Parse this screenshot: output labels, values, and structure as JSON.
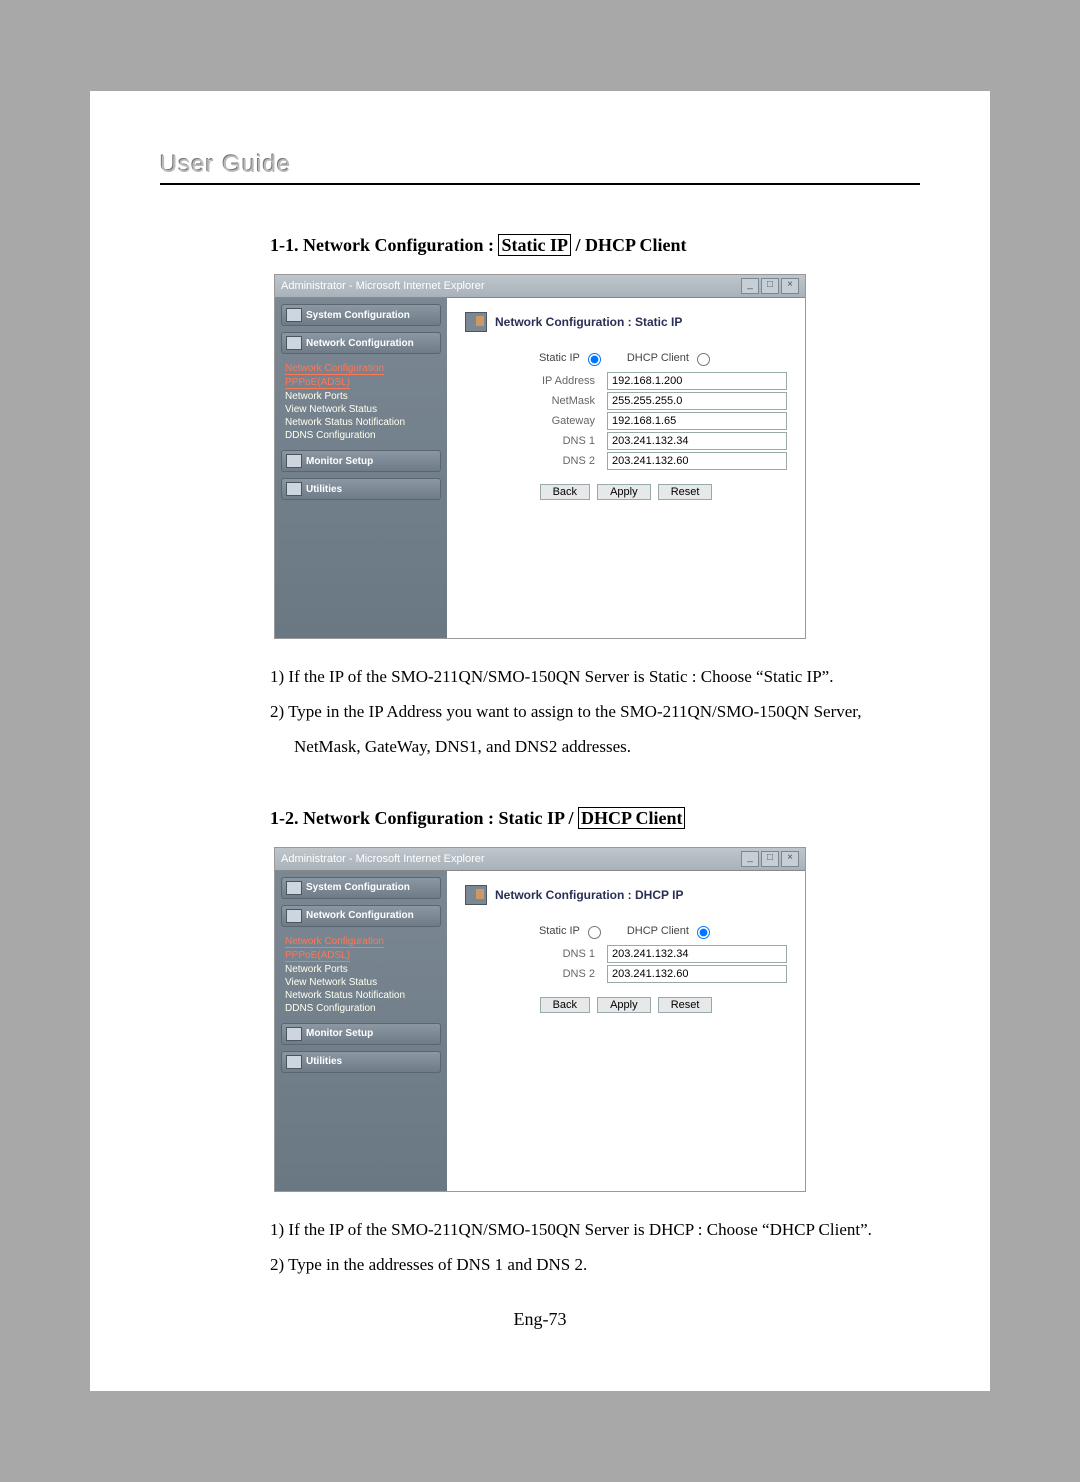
{
  "header": {
    "title": "User Guide"
  },
  "section1": {
    "prefix": "1-1. Network Configuration : ",
    "boxed": "Static IP",
    "suffix": " / DHCP Client"
  },
  "section2": {
    "prefix": "1-2. Network Configuration : Static IP / ",
    "boxed": "DHCP Client"
  },
  "windowTitle": "Administrator - Microsoft Internet Explorer",
  "sidebar": {
    "sysConfig": "System Configuration",
    "netConfig": "Network Configuration",
    "monitor": "Monitor Setup",
    "utilities": "Utilities",
    "links": {
      "netConfig": "Network Configuration",
      "pppoe": "PPPoE(ADSL)",
      "ports": "Network Ports",
      "viewStatus": "View Network Status",
      "notif": "Network Status Notification",
      "ddns": "DDNS Configuration"
    }
  },
  "panel1": {
    "title": "Network Configuration : Static IP",
    "radioStatic": "Static IP",
    "radioDHCP": "DHCP Client",
    "labels": {
      "ip": "IP Address",
      "netmask": "NetMask",
      "gateway": "Gateway",
      "dns1": "DNS 1",
      "dns2": "DNS 2"
    },
    "values": {
      "ip": "192.168.1.200",
      "netmask": "255.255.255.0",
      "gateway": "192.168.1.65",
      "dns1": "203.241.132.34",
      "dns2": "203.241.132.60"
    }
  },
  "panel2": {
    "title": "Network Configuration : DHCP IP",
    "radioStatic": "Static IP",
    "radioDHCP": "DHCP Client",
    "labels": {
      "dns1": "DNS 1",
      "dns2": "DNS 2"
    },
    "values": {
      "dns1": "203.241.132.34",
      "dns2": "203.241.132.60"
    }
  },
  "buttons": {
    "back": "Back",
    "apply": "Apply",
    "reset": "Reset"
  },
  "body1a": "1) If the IP of the SMO-211QN/SMO-150QN Server is Static : Choose “Static IP”.",
  "body1b": "2) Type in the IP Address you want to assign to the SMO-211QN/SMO-150QN Server,",
  "body1c": "NetMask, GateWay, DNS1, and DNS2 addresses.",
  "body2a": "1) If the IP of the SMO-211QN/SMO-150QN Server is DHCP : Choose “DHCP Client”.",
  "body2b": "2) Type in the addresses of DNS 1 and DNS 2.",
  "pageNum": "Eng-73"
}
